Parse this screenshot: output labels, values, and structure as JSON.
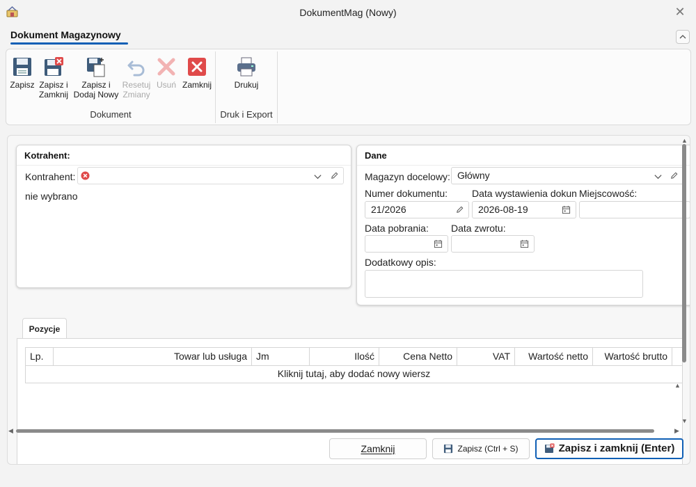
{
  "window": {
    "title": "DokumentMag (Nowy)",
    "close_glyph": "✕"
  },
  "ribbon": {
    "tab_label": "Dokument Magazynowy",
    "collapse_glyph": "^",
    "groups": [
      {
        "label": "Dokument",
        "buttons": [
          {
            "line1": "Zapisz",
            "line2": "",
            "icon": "floppy-disk-icon",
            "enabled": true
          },
          {
            "line1": "Zapisz i",
            "line2": "Zamknij",
            "icon": "floppy-disk-close-icon",
            "enabled": true
          },
          {
            "line1": "Zapisz i",
            "line2": "Dodaj Nowy",
            "icon": "floppy-disk-new-icon",
            "enabled": true
          },
          {
            "line1": "Resetuj",
            "line2": "Zmiany",
            "icon": "undo-icon",
            "enabled": false
          },
          {
            "line1": "Usuń",
            "line2": "",
            "icon": "delete-x-icon",
            "enabled": false
          },
          {
            "line1": "Zamknij",
            "line2": "",
            "icon": "close-red-icon",
            "enabled": true
          }
        ]
      },
      {
        "label": "Druk i Export",
        "buttons": [
          {
            "line1": "Drukuj",
            "line2": "",
            "icon": "printer-icon",
            "enabled": true
          }
        ]
      }
    ]
  },
  "kontrahent": {
    "title": "Kotrahent:",
    "label": "Kontrahent:",
    "value": "",
    "status": "nie wybrano"
  },
  "dane": {
    "title": "Dane",
    "magazyn_label": "Magazyn docelowy:",
    "magazyn_value": "Główny",
    "numer_label": "Numer dokumentu:",
    "numer_value": "21/2026",
    "data_wyst_label": "Data wystawienia dokun",
    "data_wyst_value": "2026-08-19",
    "miejscowosc_label": "Miejscowość:",
    "miejscowosc_value": "",
    "data_pobrania_label": "Data pobrania:",
    "data_pobrania_value": "",
    "data_zwrotu_label": "Data zwrotu:",
    "data_zwrotu_value": "",
    "opis_label": "Dodatkowy opis:",
    "opis_value": ""
  },
  "positions": {
    "tab_label": "Pozycje",
    "columns": [
      "Lp.",
      "Towar lub usługa",
      "Jm",
      "Ilość",
      "Cena Netto",
      "VAT",
      "Wartość netto",
      "Wartość brutto"
    ],
    "new_row_text": "Kliknij tutaj, aby dodać nowy wiersz"
  },
  "footer": {
    "close_label": "Zamknij",
    "save_label": "Zapisz (Ctrl + S)",
    "save_close_label": "Zapisz i zamknij (Enter)"
  },
  "colors": {
    "accent": "#0f5fb5",
    "error_red": "#e04a4a",
    "disabled": "#a9a9a9"
  }
}
